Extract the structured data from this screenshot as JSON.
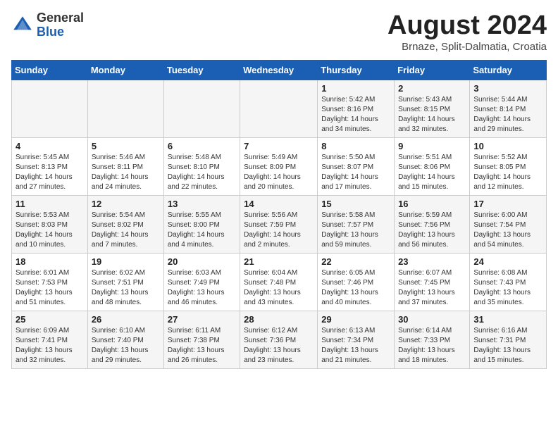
{
  "header": {
    "logo_general": "General",
    "logo_blue": "Blue",
    "month_year": "August 2024",
    "location": "Brnaze, Split-Dalmatia, Croatia"
  },
  "calendar": {
    "days_of_week": [
      "Sunday",
      "Monday",
      "Tuesday",
      "Wednesday",
      "Thursday",
      "Friday",
      "Saturday"
    ],
    "weeks": [
      [
        {
          "day": "",
          "info": ""
        },
        {
          "day": "",
          "info": ""
        },
        {
          "day": "",
          "info": ""
        },
        {
          "day": "",
          "info": ""
        },
        {
          "day": "1",
          "info": "Sunrise: 5:42 AM\nSunset: 8:16 PM\nDaylight: 14 hours\nand 34 minutes."
        },
        {
          "day": "2",
          "info": "Sunrise: 5:43 AM\nSunset: 8:15 PM\nDaylight: 14 hours\nand 32 minutes."
        },
        {
          "day": "3",
          "info": "Sunrise: 5:44 AM\nSunset: 8:14 PM\nDaylight: 14 hours\nand 29 minutes."
        }
      ],
      [
        {
          "day": "4",
          "info": "Sunrise: 5:45 AM\nSunset: 8:13 PM\nDaylight: 14 hours\nand 27 minutes."
        },
        {
          "day": "5",
          "info": "Sunrise: 5:46 AM\nSunset: 8:11 PM\nDaylight: 14 hours\nand 24 minutes."
        },
        {
          "day": "6",
          "info": "Sunrise: 5:48 AM\nSunset: 8:10 PM\nDaylight: 14 hours\nand 22 minutes."
        },
        {
          "day": "7",
          "info": "Sunrise: 5:49 AM\nSunset: 8:09 PM\nDaylight: 14 hours\nand 20 minutes."
        },
        {
          "day": "8",
          "info": "Sunrise: 5:50 AM\nSunset: 8:07 PM\nDaylight: 14 hours\nand 17 minutes."
        },
        {
          "day": "9",
          "info": "Sunrise: 5:51 AM\nSunset: 8:06 PM\nDaylight: 14 hours\nand 15 minutes."
        },
        {
          "day": "10",
          "info": "Sunrise: 5:52 AM\nSunset: 8:05 PM\nDaylight: 14 hours\nand 12 minutes."
        }
      ],
      [
        {
          "day": "11",
          "info": "Sunrise: 5:53 AM\nSunset: 8:03 PM\nDaylight: 14 hours\nand 10 minutes."
        },
        {
          "day": "12",
          "info": "Sunrise: 5:54 AM\nSunset: 8:02 PM\nDaylight: 14 hours\nand 7 minutes."
        },
        {
          "day": "13",
          "info": "Sunrise: 5:55 AM\nSunset: 8:00 PM\nDaylight: 14 hours\nand 4 minutes."
        },
        {
          "day": "14",
          "info": "Sunrise: 5:56 AM\nSunset: 7:59 PM\nDaylight: 14 hours\nand 2 minutes."
        },
        {
          "day": "15",
          "info": "Sunrise: 5:58 AM\nSunset: 7:57 PM\nDaylight: 13 hours\nand 59 minutes."
        },
        {
          "day": "16",
          "info": "Sunrise: 5:59 AM\nSunset: 7:56 PM\nDaylight: 13 hours\nand 56 minutes."
        },
        {
          "day": "17",
          "info": "Sunrise: 6:00 AM\nSunset: 7:54 PM\nDaylight: 13 hours\nand 54 minutes."
        }
      ],
      [
        {
          "day": "18",
          "info": "Sunrise: 6:01 AM\nSunset: 7:53 PM\nDaylight: 13 hours\nand 51 minutes."
        },
        {
          "day": "19",
          "info": "Sunrise: 6:02 AM\nSunset: 7:51 PM\nDaylight: 13 hours\nand 48 minutes."
        },
        {
          "day": "20",
          "info": "Sunrise: 6:03 AM\nSunset: 7:49 PM\nDaylight: 13 hours\nand 46 minutes."
        },
        {
          "day": "21",
          "info": "Sunrise: 6:04 AM\nSunset: 7:48 PM\nDaylight: 13 hours\nand 43 minutes."
        },
        {
          "day": "22",
          "info": "Sunrise: 6:05 AM\nSunset: 7:46 PM\nDaylight: 13 hours\nand 40 minutes."
        },
        {
          "day": "23",
          "info": "Sunrise: 6:07 AM\nSunset: 7:45 PM\nDaylight: 13 hours\nand 37 minutes."
        },
        {
          "day": "24",
          "info": "Sunrise: 6:08 AM\nSunset: 7:43 PM\nDaylight: 13 hours\nand 35 minutes."
        }
      ],
      [
        {
          "day": "25",
          "info": "Sunrise: 6:09 AM\nSunset: 7:41 PM\nDaylight: 13 hours\nand 32 minutes."
        },
        {
          "day": "26",
          "info": "Sunrise: 6:10 AM\nSunset: 7:40 PM\nDaylight: 13 hours\nand 29 minutes."
        },
        {
          "day": "27",
          "info": "Sunrise: 6:11 AM\nSunset: 7:38 PM\nDaylight: 13 hours\nand 26 minutes."
        },
        {
          "day": "28",
          "info": "Sunrise: 6:12 AM\nSunset: 7:36 PM\nDaylight: 13 hours\nand 23 minutes."
        },
        {
          "day": "29",
          "info": "Sunrise: 6:13 AM\nSunset: 7:34 PM\nDaylight: 13 hours\nand 21 minutes."
        },
        {
          "day": "30",
          "info": "Sunrise: 6:14 AM\nSunset: 7:33 PM\nDaylight: 13 hours\nand 18 minutes."
        },
        {
          "day": "31",
          "info": "Sunrise: 6:16 AM\nSunset: 7:31 PM\nDaylight: 13 hours\nand 15 minutes."
        }
      ]
    ]
  }
}
